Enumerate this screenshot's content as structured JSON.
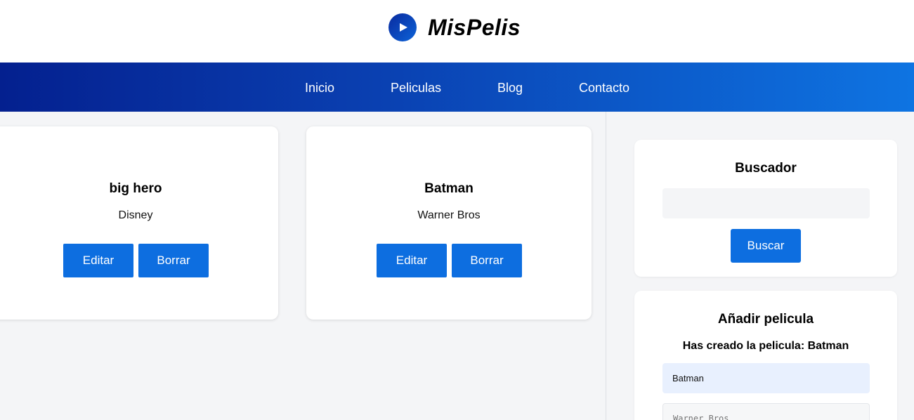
{
  "brand": {
    "name": "MisPelis",
    "icon": "play-icon"
  },
  "nav": {
    "items": [
      {
        "label": "Inicio"
      },
      {
        "label": "Peliculas"
      },
      {
        "label": "Blog"
      },
      {
        "label": "Contacto"
      }
    ]
  },
  "movies": [
    {
      "title": "big hero",
      "studio": "Disney",
      "edit_label": "Editar",
      "delete_label": "Borrar"
    },
    {
      "title": "Batman",
      "studio": "Warner Bros",
      "edit_label": "Editar",
      "delete_label": "Borrar"
    }
  ],
  "search": {
    "title": "Buscador",
    "value": "",
    "button_label": "Buscar"
  },
  "add_movie": {
    "title": "Añadir pelicula",
    "notice": "Has creado la pelicula: Batman",
    "title_value": "Batman",
    "studio_placeholder": "Warner Bros"
  },
  "colors": {
    "accent": "#0d6ee0",
    "nav_start": "#04208f",
    "nav_end": "#0e74e2",
    "background": "#f4f5f7"
  }
}
